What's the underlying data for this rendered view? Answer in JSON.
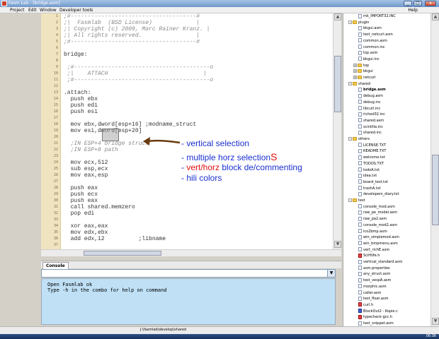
{
  "window": {
    "title": "Fasm Lab - [bridge.asm]",
    "controls": [
      "_",
      "□",
      "x"
    ]
  },
  "menu": {
    "items": [
      "Project",
      "Edit",
      "Window",
      "Developer tools"
    ],
    "help": "Help"
  },
  "editor": {
    "lines": [
      {
        "n": "1",
        "text": ";#-------------------------------------#",
        "cls": "cmt"
      },
      {
        "n": "2",
        "text": ";|  Fasmlab  (BSD License)             |",
        "cls": "cmt"
      },
      {
        "n": "3",
        "text": ";| Copyright (c) 2009, Marc Rainer Kranz. |",
        "cls": "cmt"
      },
      {
        "n": "4",
        "text": ";| All rights reserved.                |",
        "cls": "cmt"
      },
      {
        "n": "5",
        "text": ";#-------------------------------------#",
        "cls": "cmt"
      },
      {
        "n": "6",
        "text": "",
        "cls": ""
      },
      {
        "n": "7",
        "text": "bridge:",
        "cls": "kw"
      },
      {
        "n": "8",
        "text": "",
        "cls": ""
      },
      {
        "n": "9",
        "text": " ;#----------------------------------------o",
        "cls": "cmt"
      },
      {
        "n": "10",
        "text": " ;|    ATTACH                            |",
        "cls": "cmt"
      },
      {
        "n": "11",
        "text": " ;#----------------------------------------o",
        "cls": "cmt"
      },
      {
        "n": "12",
        "text": "",
        "cls": ""
      },
      {
        "n": "13",
        "text": ".attach:",
        "cls": "kw"
      },
      {
        "n": "14",
        "text": "  push ebx",
        "cls": "kw"
      },
      {
        "n": "15",
        "text": "  push edi",
        "cls": "kw"
      },
      {
        "n": "16",
        "text": "  push esi",
        "cls": "kw"
      },
      {
        "n": "17",
        "text": "",
        "cls": ""
      },
      {
        "n": "18",
        "text": "  mov ebx,dword[esp+16] ;modname_struct",
        "cls": "kw"
      },
      {
        "n": "19",
        "text": "  mov esi,dword[esp+20]",
        "cls": "kw"
      },
      {
        "n": "20",
        "text": "",
        "cls": ""
      },
      {
        "n": "21",
        "text": "  ;IN ESP+4 bridge struct",
        "cls": "cmt"
      },
      {
        "n": "22",
        "text": "  ;IN ESP+8 path",
        "cls": "cmt"
      },
      {
        "n": "23",
        "text": "",
        "cls": ""
      },
      {
        "n": "24",
        "text": "  mov ecx,512",
        "cls": "kw"
      },
      {
        "n": "25",
        "text": "  sub esp,ecx",
        "cls": "kw"
      },
      {
        "n": "26",
        "text": "  mov eax,esp",
        "cls": "kw"
      },
      {
        "n": "27",
        "text": "",
        "cls": ""
      },
      {
        "n": "28",
        "text": "  push eax",
        "cls": "kw"
      },
      {
        "n": "29",
        "text": "  push ecx",
        "cls": "kw"
      },
      {
        "n": "30",
        "text": "  push eax",
        "cls": "kw"
      },
      {
        "n": "31",
        "text": "  call shared.memzero",
        "cls": "kw"
      },
      {
        "n": "32",
        "text": "  pop edi",
        "cls": "kw"
      },
      {
        "n": "33",
        "text": "",
        "cls": ""
      },
      {
        "n": "34",
        "text": "  xor eax,eax",
        "cls": "kw"
      },
      {
        "n": "35",
        "text": "  mov edx,ebx",
        "cls": "kw"
      },
      {
        "n": "36",
        "text": "  add edx,12          ;libname",
        "cls": "kw"
      },
      {
        "n": "37",
        "text": "",
        "cls": ""
      }
    ]
  },
  "annotations": {
    "vertical_selection": "- vertical selection",
    "multiple_horz_prefix": "- multiple horz selection",
    "multiple_horz_s": "S",
    "block_prefix": "- ",
    "block_vert_horz": "vert/horz",
    "block_suffix": " block de/commenting",
    "hili": "- hili colors",
    "colors": {
      "blue": "#1a2fd0",
      "red": "#e01010",
      "arrow": "#6b3a0e"
    }
  },
  "console": {
    "tab_label": "Console",
    "combo_value": "",
    "output": [
      "Open Fasmlab ok",
      "Type -h in the combo for help on command"
    ]
  },
  "status": {
    "path": "J:\\fasmlab\\develop\\shared",
    "clock": "06:36"
  },
  "tree": {
    "nodes": [
      {
        "label": "mk_IMPORT32.INC",
        "indent": 3,
        "type": "file"
      },
      {
        "label": "plugin",
        "indent": 1,
        "type": "folder",
        "exp": "-"
      },
      {
        "label": "bkgui.asm",
        "indent": 3,
        "type": "file"
      },
      {
        "label": "test_netcurl.asm",
        "indent": 3,
        "type": "file"
      },
      {
        "label": "common.asm",
        "indent": 3,
        "type": "file"
      },
      {
        "label": "common.inc",
        "indent": 3,
        "type": "file"
      },
      {
        "label": "top.asm",
        "indent": 3,
        "type": "file"
      },
      {
        "label": "bkgui.inc",
        "indent": 3,
        "type": "file"
      },
      {
        "label": "top",
        "indent": 2,
        "type": "folder",
        "exp": "+"
      },
      {
        "label": "bkgui",
        "indent": 2,
        "type": "folder",
        "exp": "+"
      },
      {
        "label": "netcurl",
        "indent": 2,
        "type": "folder",
        "exp": "+"
      },
      {
        "label": "shared",
        "indent": 1,
        "type": "folder",
        "exp": "-"
      },
      {
        "label": "bridge.asm",
        "indent": 3,
        "type": "file",
        "bold": true
      },
      {
        "label": "debug.asm",
        "indent": 3,
        "type": "file"
      },
      {
        "label": "debug.inc",
        "indent": 3,
        "type": "file"
      },
      {
        "label": "libcurl.inc",
        "indent": 3,
        "type": "file"
      },
      {
        "label": "riched32.inc",
        "indent": 3,
        "type": "file"
      },
      {
        "label": "shared.asm",
        "indent": 3,
        "type": "file"
      },
      {
        "label": "scintilla.inc",
        "indent": 3,
        "type": "file"
      },
      {
        "label": "shared.inc",
        "indent": 3,
        "type": "file"
      },
      {
        "label": "others",
        "indent": 1,
        "type": "folder",
        "exp": "-"
      },
      {
        "label": "LICENSE.TXT",
        "indent": 3,
        "type": "file"
      },
      {
        "label": "README.TXT",
        "indent": 3,
        "type": "file"
      },
      {
        "label": "welcome.txt",
        "indent": 3,
        "type": "file"
      },
      {
        "label": "TODOS.TXT",
        "indent": 3,
        "type": "file"
      },
      {
        "label": "todoA.txt",
        "indent": 3,
        "type": "file"
      },
      {
        "label": "idea.txt",
        "indent": 3,
        "type": "file"
      },
      {
        "label": "board_test.txt",
        "indent": 3,
        "type": "file"
      },
      {
        "label": "trashA.txt",
        "indent": 3,
        "type": "file"
      },
      {
        "label": "developers_diary.txt",
        "indent": 3,
        "type": "file"
      },
      {
        "label": "test",
        "indent": 1,
        "type": "folder",
        "exp": "-"
      },
      {
        "label": "console_mod.asm",
        "indent": 3,
        "type": "file"
      },
      {
        "label": "raw_pe_model.asm",
        "indent": 3,
        "type": "file"
      },
      {
        "label": "raw_pa2.asm",
        "indent": 3,
        "type": "file"
      },
      {
        "label": "console_mod2.asm",
        "indent": 3,
        "type": "file"
      },
      {
        "label": "ico2bmp.asm",
        "indent": 3,
        "type": "file"
      },
      {
        "label": "win_simplemod.asm",
        "indent": 3,
        "type": "file"
      },
      {
        "label": "win_bmpmenu.asm",
        "indent": 3,
        "type": "file"
      },
      {
        "label": "vert_richE.asm",
        "indent": 3,
        "type": "file"
      },
      {
        "label": "SciHilfe.h",
        "indent": 3,
        "type": "file-red"
      },
      {
        "label": "vertical_standard.asm",
        "indent": 3,
        "type": "file"
      },
      {
        "label": "asm.properties",
        "indent": 3,
        "type": "file"
      },
      {
        "label": "any_struct.asm",
        "indent": 3,
        "type": "file"
      },
      {
        "label": "test_vespA.asm",
        "indent": 3,
        "type": "file"
      },
      {
        "label": "morphic.asm",
        "indent": 3,
        "type": "file"
      },
      {
        "label": "caller.asm",
        "indent": 3,
        "type": "file"
      },
      {
        "label": "test_float.asm",
        "indent": 3,
        "type": "file"
      },
      {
        "label": "curl.h",
        "indent": 3,
        "type": "file-red"
      },
      {
        "label": "BlockOut2 - Kopie.c",
        "indent": 3,
        "type": "file-blue"
      },
      {
        "label": "typecheck-gcc.h",
        "indent": 3,
        "type": "file-red"
      },
      {
        "label": "test_snippet.asm",
        "indent": 3,
        "type": "file"
      }
    ]
  }
}
